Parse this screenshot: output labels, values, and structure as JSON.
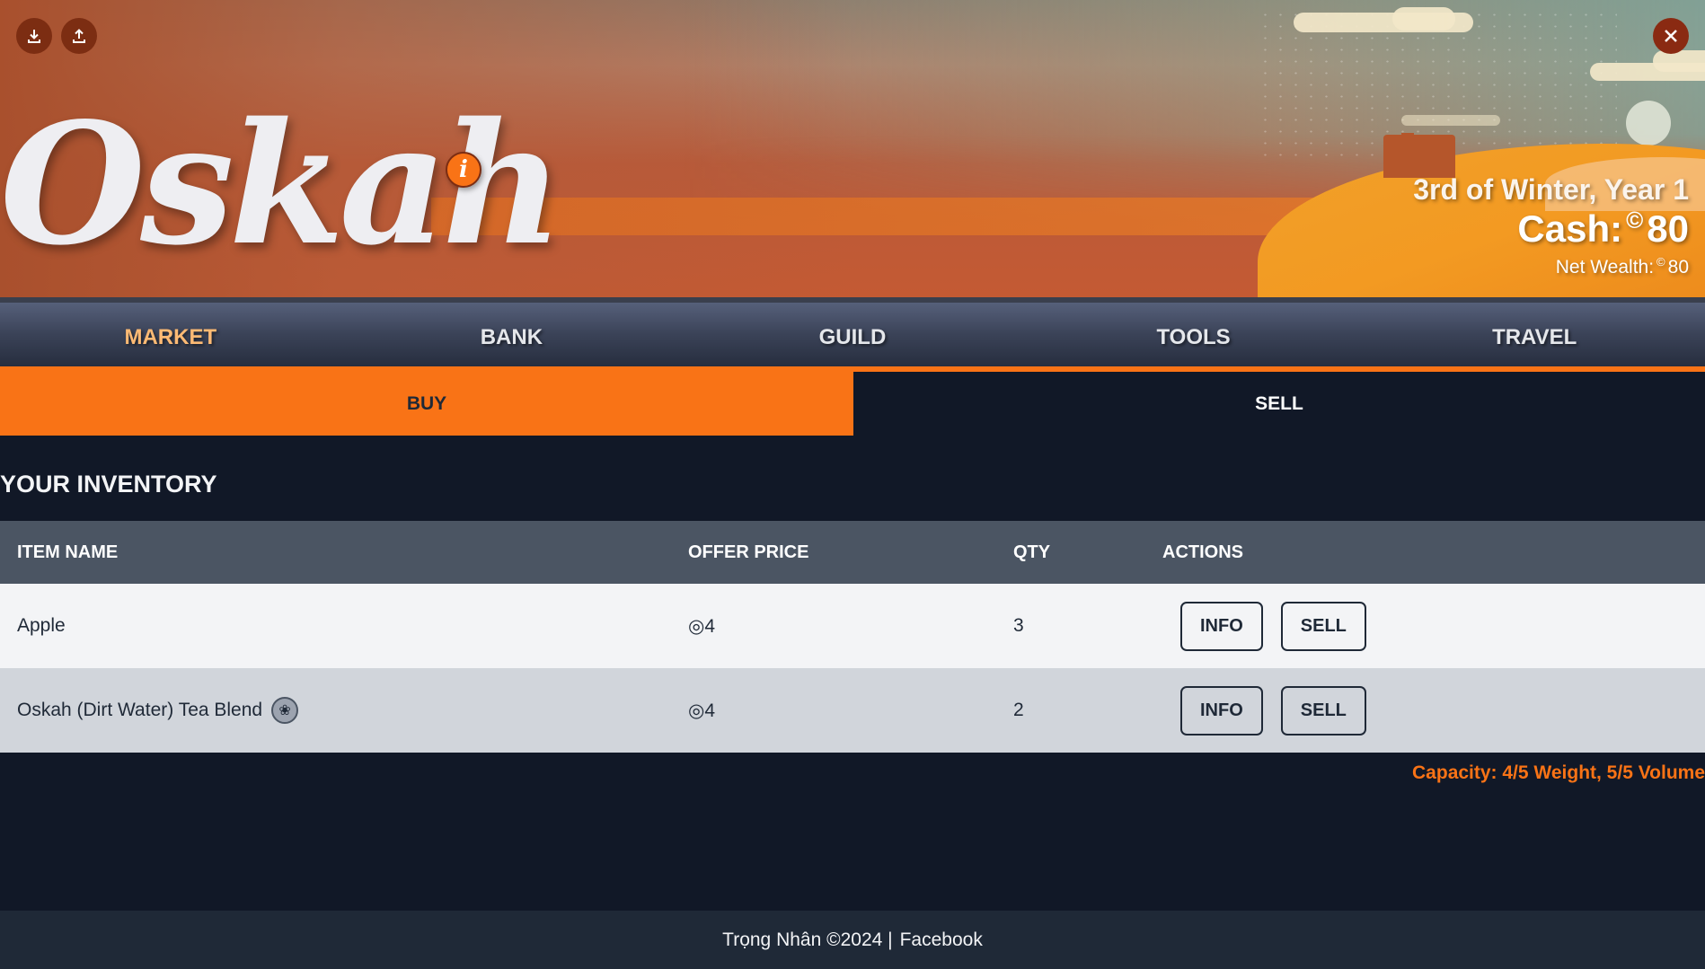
{
  "header": {
    "logo_text": "Oskah",
    "info_badge": "i",
    "download_icon": "download-icon",
    "upload_icon": "upload-icon",
    "close_icon": "close-icon",
    "date": "3rd of Winter, Year 1",
    "cash_label": "Cash:",
    "cash_symbol": "©",
    "cash_value": "80",
    "net_wealth_label": "Net Wealth:",
    "net_wealth_symbol": "©",
    "net_wealth_value": "80"
  },
  "nav": {
    "tabs": [
      {
        "label": "MARKET",
        "active": true
      },
      {
        "label": "BANK",
        "active": false
      },
      {
        "label": "GUILD",
        "active": false
      },
      {
        "label": "TOOLS",
        "active": false
      },
      {
        "label": "TRAVEL",
        "active": false
      }
    ]
  },
  "subtabs": {
    "buy": "BUY",
    "sell": "SELL",
    "active": "buy"
  },
  "inventory": {
    "title": "YOUR INVENTORY",
    "columns": [
      "ITEM NAME",
      "OFFER PRICE",
      "QTY",
      "ACTIONS"
    ],
    "rows": [
      {
        "name": "Apple",
        "price": "◎4",
        "qty": "3",
        "info_label": "INFO",
        "sell_label": "SELL",
        "has_icon": false
      },
      {
        "name": "Oskah (Dirt Water) Tea Blend",
        "price": "◎4",
        "qty": "2",
        "info_label": "INFO",
        "sell_label": "SELL",
        "has_icon": true,
        "icon": "tea-icon"
      }
    ],
    "capacity": "Capacity: 4/5 Weight, 5/5 Volume"
  },
  "footer": {
    "text": "Trọng Nhân ©2024 |",
    "link": "Facebook"
  },
  "colors": {
    "accent": "#f97316",
    "background": "#111827",
    "nav_active": "#fdba74",
    "table_header": "#4b5563",
    "row_light": "#f3f4f6",
    "row_dark": "#d1d5db"
  }
}
